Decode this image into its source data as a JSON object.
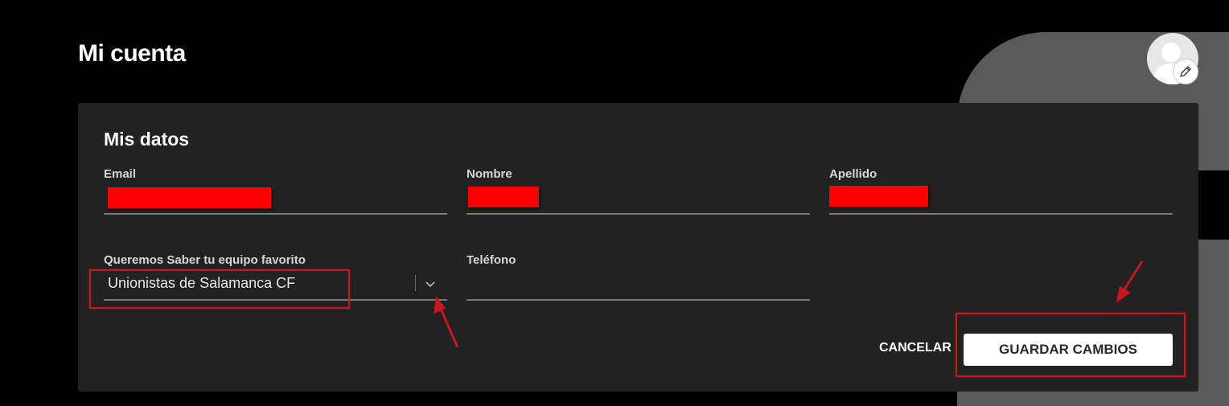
{
  "page": {
    "title": "Mi cuenta"
  },
  "avatar": {
    "icon": "user-silhouette-icon",
    "edit_icon": "pencil-icon"
  },
  "card": {
    "title": "Mis datos",
    "fields": {
      "email": {
        "label": "Email",
        "value_redacted": true
      },
      "nombre": {
        "label": "Nombre",
        "value_redacted": true
      },
      "apellido": {
        "label": "Apellido",
        "value_redacted": true
      },
      "equipo": {
        "label": "Queremos Saber tu equipo favorito",
        "value": "Unionistas de Salamanca CF",
        "icon": "chevron-down-icon"
      },
      "telefono": {
        "label": "Teléfono",
        "value": ""
      }
    },
    "actions": {
      "cancel_label": "CANCELAR",
      "save_label": "GUARDAR CAMBIOS"
    }
  },
  "colors": {
    "background": "#000000",
    "card": "#222222",
    "annotation": "#c8171e",
    "redaction": "#ff0000"
  }
}
